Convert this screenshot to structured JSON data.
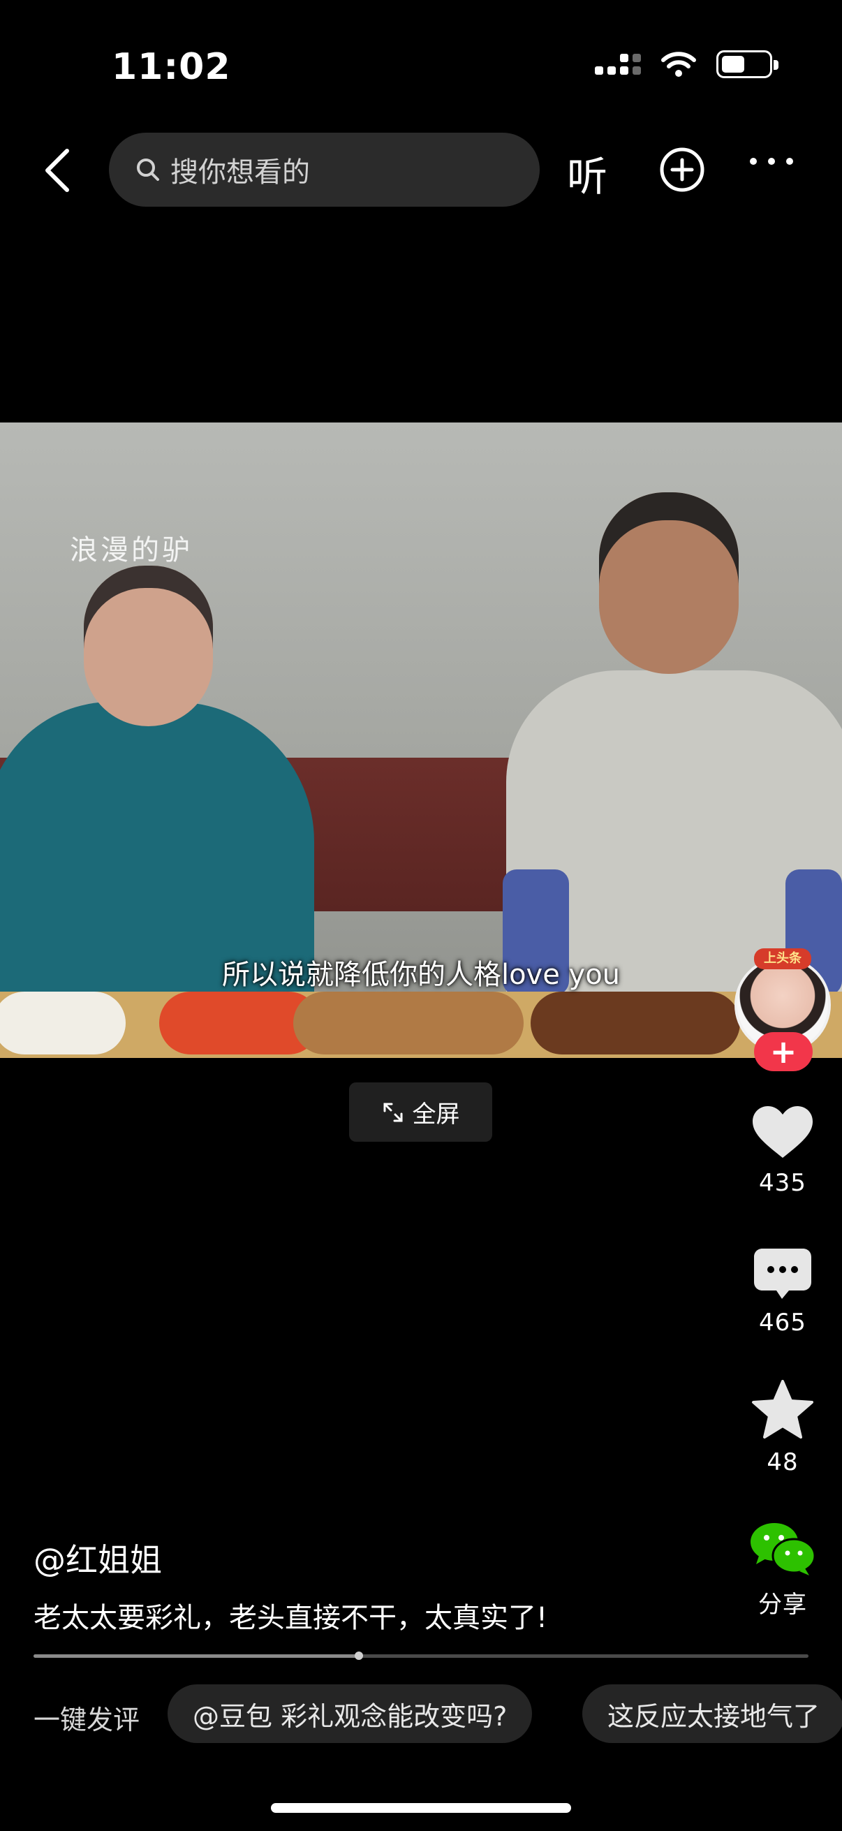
{
  "status_bar": {
    "time": "11:02",
    "battery_level": 0.45
  },
  "nav": {
    "search_placeholder": "搜你想看的",
    "listen_label": "听"
  },
  "video": {
    "watermark": "浪漫的驴",
    "subtitle": "所以说就降低你的人格love you",
    "avatar_badge": "上头条",
    "follow_label": "+"
  },
  "fullscreen_label": "全屏",
  "actions": {
    "like_count": "435",
    "comment_count": "465",
    "favorite_count": "48",
    "share_label": "分享"
  },
  "post": {
    "author": "@红姐姐",
    "caption": "老太太要彩礼，老头直接不干，太真实了!",
    "progress": 0.42
  },
  "quick_comment": {
    "label": "一键发评",
    "chips": [
      "@豆包 彩礼观念能改变吗?",
      "这反应太接地气了"
    ]
  },
  "colors": {
    "accent_red": "#f2364a",
    "background": "#000000",
    "chip_bg": "#252525",
    "share_green": "#2dc100"
  }
}
